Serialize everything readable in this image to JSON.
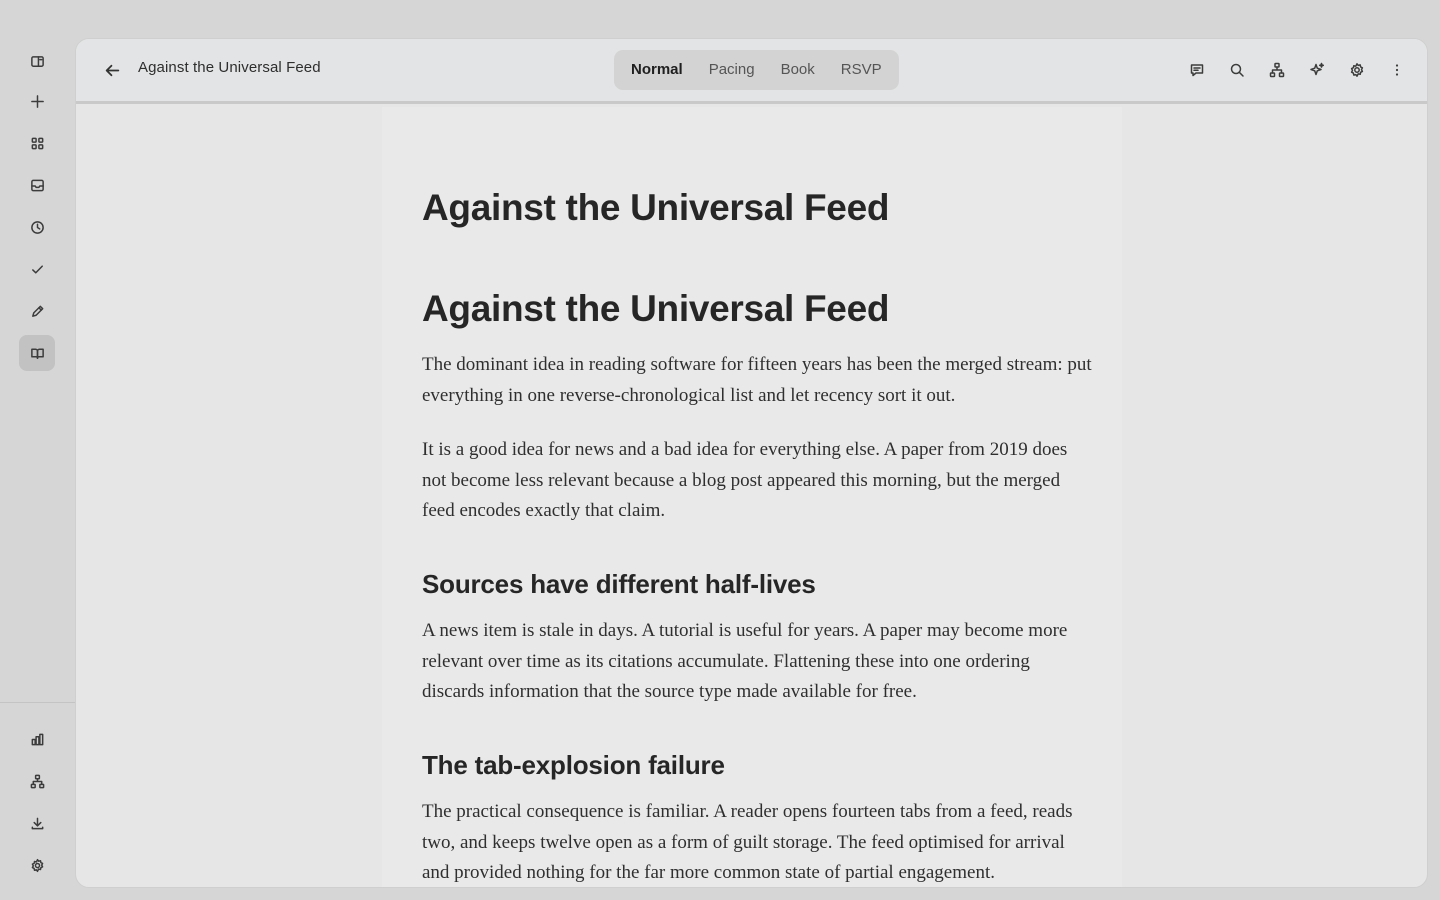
{
  "rail": {
    "top_items": [
      {
        "icon": "sidebar-toggle-icon",
        "active": false
      },
      {
        "icon": "plus-icon",
        "active": false
      },
      {
        "icon": "grid-icon",
        "active": false
      },
      {
        "icon": "inbox-icon",
        "active": false
      },
      {
        "icon": "clock-icon",
        "active": false
      },
      {
        "icon": "check-icon",
        "active": false
      },
      {
        "icon": "pencil-icon",
        "active": false
      },
      {
        "icon": "book-icon",
        "active": true
      }
    ],
    "bottom_items": [
      {
        "icon": "bar-chart-icon"
      },
      {
        "icon": "hierarchy-icon"
      },
      {
        "icon": "download-icon"
      },
      {
        "icon": "gear-icon"
      }
    ]
  },
  "toolbar": {
    "title": "Against the Universal Feed",
    "modes": [
      "Normal",
      "Pacing",
      "Book",
      "RSVP"
    ],
    "active_mode": "Normal",
    "tools": [
      "comment-icon",
      "search-icon",
      "hierarchy-icon",
      "sparkle-icon",
      "gear-icon",
      "more-vertical-icon"
    ]
  },
  "document": {
    "title": "Against the Universal Feed",
    "heading": "Against the Universal Feed",
    "p1": "The dominant idea in reading software for fifteen years has been the merged stream: put everything in one reverse-chronological list and let recency sort it out.",
    "p2": "It is a good idea for news and a bad idea for everything else. A paper from 2019 does not become less relevant because a blog post appeared this morning, but the merged feed encodes exactly that claim.",
    "h2_1": "Sources have different half-lives",
    "p3": "A news item is stale in days. A tutorial is useful for years. A paper may become more relevant over time as its citations accumulate. Flattening these into one ordering discards information that the source type made available for free.",
    "h2_2": "The tab-explosion failure",
    "p4": "The practical consequence is familiar. A reader opens fourteen tabs from a feed, reads two, and keeps twelve open as a form of guilt storage. The feed optimised for arrival and provided nothing for the far more common state of partial engagement."
  }
}
